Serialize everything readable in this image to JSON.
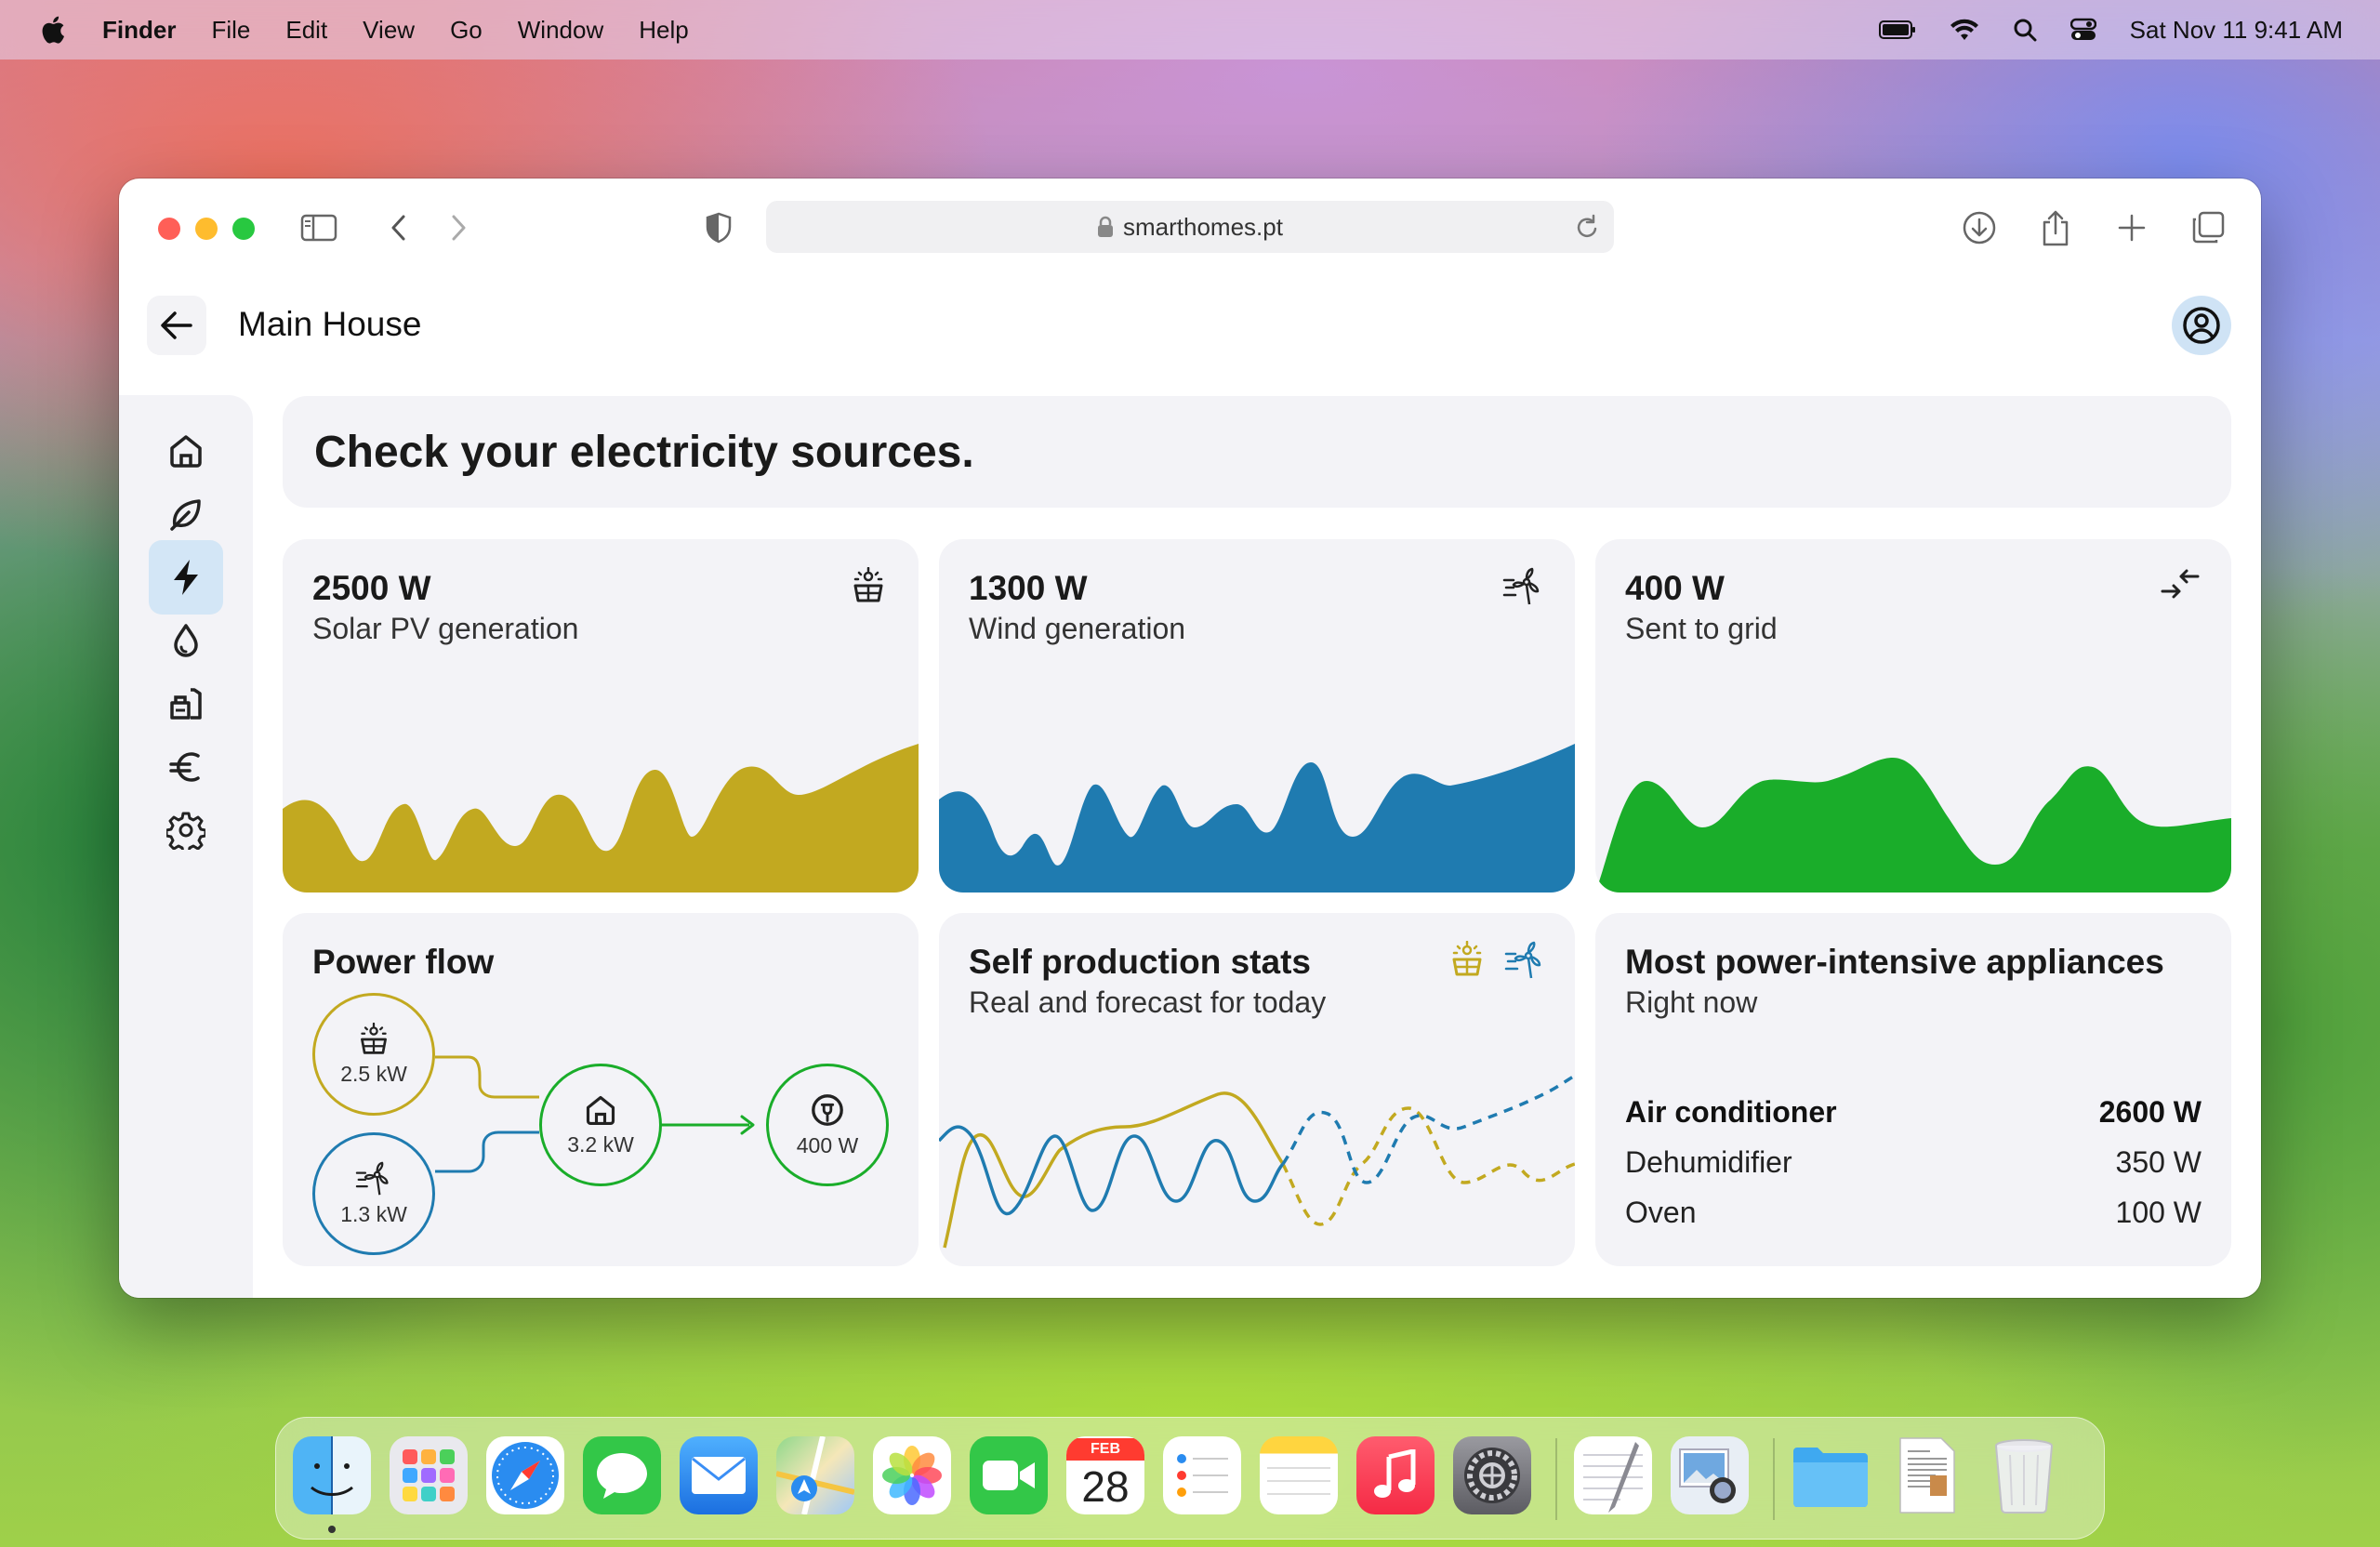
{
  "menubar": {
    "app": "Finder",
    "items": [
      "File",
      "Edit",
      "View",
      "Go",
      "Window",
      "Help"
    ],
    "clock": "Sat Nov 11  9:41 AM"
  },
  "browser": {
    "url": "smarthomes.pt"
  },
  "app": {
    "title": "Main House",
    "headline": "Check your electricity sources.",
    "nav": [
      {
        "icon": "home-icon"
      },
      {
        "icon": "leaf-icon"
      },
      {
        "icon": "lightning-icon",
        "active": true
      },
      {
        "icon": "water-drop-icon"
      },
      {
        "icon": "gas-heater-icon"
      },
      {
        "icon": "euro-icon"
      },
      {
        "icon": "settings-gear-icon"
      }
    ]
  },
  "sources": [
    {
      "value": "2500 W",
      "label": "Solar PV generation",
      "icon": "solar-panel-icon",
      "color": "#c2a920"
    },
    {
      "value": "1300 W",
      "label": "Wind generation",
      "icon": "wind-turbine-icon",
      "color": "#1f7bb0"
    },
    {
      "value": "400 W",
      "label": "Sent to grid",
      "icon": "grid-exchange-icon",
      "color": "#1aad2a"
    }
  ],
  "power_flow": {
    "title": "Power flow",
    "solar": "2.5 kW",
    "wind": "1.3 kW",
    "house": "3.2 kW",
    "grid": "400 W",
    "colors": {
      "solar": "#c2a920",
      "wind": "#1f7bb0",
      "house": "#1aad2a"
    }
  },
  "self_production": {
    "title": "Self production stats",
    "subtitle": "Real and forecast for today"
  },
  "appliances": {
    "title": "Most power-intensive appliances",
    "subtitle": "Right now",
    "rows": [
      {
        "name": "Air conditioner",
        "value": "2600 W"
      },
      {
        "name": "Dehumidifier",
        "value": "350 W"
      },
      {
        "name": "Oven",
        "value": "100 W"
      }
    ]
  },
  "dock": {
    "calendar_month": "FEB",
    "calendar_day": "28",
    "apps": [
      "finder-icon",
      "launchpad-icon",
      "safari-icon",
      "messages-icon",
      "mail-icon",
      "maps-icon",
      "photos-icon",
      "facetime-icon",
      "calendar-icon",
      "reminders-icon",
      "notes-icon",
      "music-icon",
      "system-settings-icon",
      "textedit-icon",
      "preview-icon",
      "folder-icon",
      "document-icon",
      "trash-icon"
    ]
  }
}
